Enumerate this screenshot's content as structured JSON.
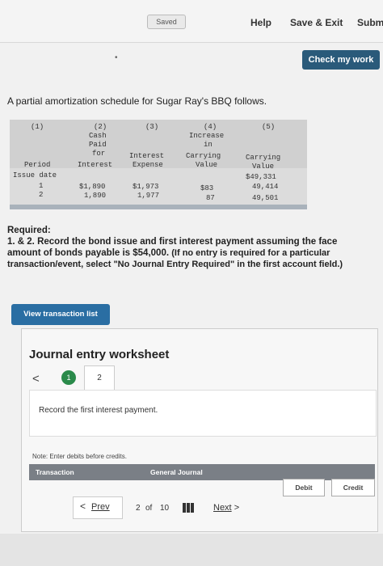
{
  "topbar": {
    "saved": "Saved",
    "help": "Help",
    "save_exit": "Save & Exit",
    "submit": "Subm"
  },
  "check_button": "Check my work",
  "question": "A partial amortization schedule for Sugar Ray's BBQ follows.",
  "schedule": {
    "col_nums": [
      "(1)",
      "(2)",
      "(3)",
      "(4)",
      "(5)"
    ],
    "col2": [
      "Cash",
      "Paid",
      "for",
      "Interest"
    ],
    "col3": [
      "Interest",
      "Expense"
    ],
    "col4": [
      "Increase",
      "in",
      "Carrying",
      "Value"
    ],
    "col5": [
      "Carrying",
      "Value"
    ],
    "col1": "Period",
    "issue_date": "Issue date",
    "issue_value": "$49,331",
    "rows": [
      {
        "period": "1",
        "cash": "$1,890",
        "interest": "$1,973",
        "increase": "$83",
        "carrying": "49,414"
      },
      {
        "period": "2",
        "cash": "1,890",
        "interest": "1,977",
        "increase": "87",
        "carrying": "49,501"
      }
    ]
  },
  "required_label": "Required:",
  "required_text": "1. & 2. Record the bond issue and first interest payment assuming the face amount of bonds payable is $54,000.",
  "required_note": "(If no entry is required for a particular transaction/event, select \"No Journal Entry Required\" in the first account field.)",
  "view_button": "View transaction list",
  "worksheet": {
    "title": "Journal entry worksheet",
    "step1": "1",
    "step2": "2",
    "record_text": "Record the first interest payment.",
    "note": "Note: Enter debits before credits.",
    "col_transaction": "Transaction",
    "col_journal": "General Journal",
    "col_debit": "Debit",
    "col_credit": "Credit"
  },
  "pager": {
    "prev": "Prev",
    "page": "2",
    "of": "of",
    "total": "10",
    "next": "Next"
  }
}
